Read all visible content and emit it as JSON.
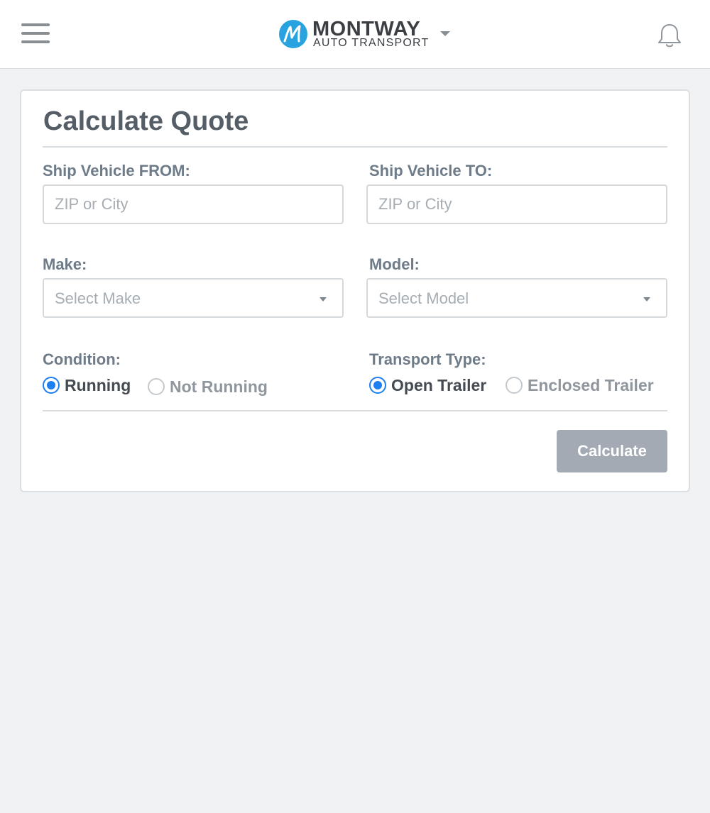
{
  "header": {
    "brand_name": "MONTWAY",
    "brand_sub": "AUTO TRANSPORT",
    "logo_letter": "M",
    "menu_icon": "hamburger-icon",
    "notification_icon": "bell-icon",
    "brand_accent": "#29a3e0"
  },
  "form": {
    "title": "Calculate Quote",
    "from": {
      "label": "Ship Vehicle FROM:",
      "placeholder": "ZIP or City",
      "value": ""
    },
    "to": {
      "label": "Ship Vehicle TO:",
      "placeholder": "ZIP or City",
      "value": ""
    },
    "make": {
      "label": "Make:",
      "selected": "Select Make"
    },
    "model": {
      "label": "Model:",
      "selected": "Select Model"
    },
    "condition": {
      "label": "Condition:",
      "options": [
        "Running",
        "Not Running"
      ],
      "selected": "Running"
    },
    "transport": {
      "label": "Transport Type:",
      "options": [
        "Open Trailer",
        "Enclosed Trailer"
      ],
      "selected": "Open Trailer"
    },
    "submit_label": "Calculate"
  },
  "colors": {
    "radio_selected": "#1e7ff0",
    "button_disabled": "#a3aab3",
    "page_background": "#f1f2f4"
  }
}
